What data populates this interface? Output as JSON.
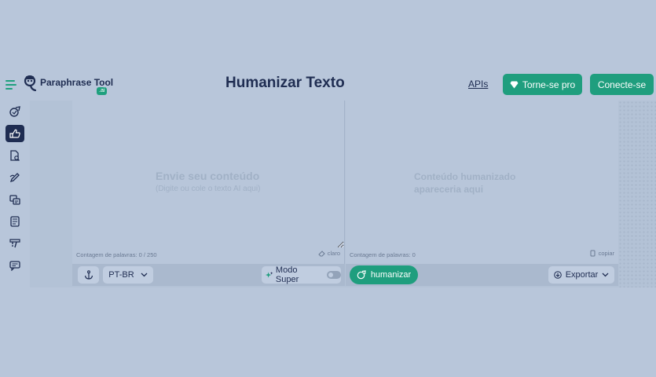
{
  "header": {
    "logo_text": "Paraphrase Tool",
    "logo_badge": ".ai",
    "title": "Humanizar Texto",
    "apis_label": "APIs",
    "pro_label": "Torne-se pro",
    "connect_label": "Conecte-se"
  },
  "sidebar": {
    "items": [
      {
        "icon": "paraphrase-icon",
        "active": false
      },
      {
        "icon": "humanize-icon",
        "active": true
      },
      {
        "icon": "document-check-icon",
        "active": false
      },
      {
        "icon": "pen-icon",
        "active": false
      },
      {
        "icon": "translate-icon",
        "active": false
      },
      {
        "icon": "summary-icon",
        "active": false
      },
      {
        "icon": "quote-icon",
        "active": false
      },
      {
        "icon": "chat-icon",
        "active": false
      }
    ]
  },
  "input_panel": {
    "placeholder_main": "Envie seu conteúdo",
    "placeholder_sub": "(Digite ou cole o texto AI aqui)",
    "word_count": "Contagem de palavras: 0 / 250",
    "clear_label": "claro"
  },
  "output_panel": {
    "placeholder": "Conteúdo humanizado apareceria aqui",
    "word_count": "Contagem de palavras: 0",
    "copy_label": "copiar"
  },
  "toolbar": {
    "language": "PT-BR",
    "modo_super_label": "Modo Super",
    "humanize_label": "humanizar",
    "export_label": "Exportar"
  },
  "colors": {
    "accent": "#1f9e7e",
    "navy": "#1f2d52",
    "background": "#b8c6da"
  }
}
